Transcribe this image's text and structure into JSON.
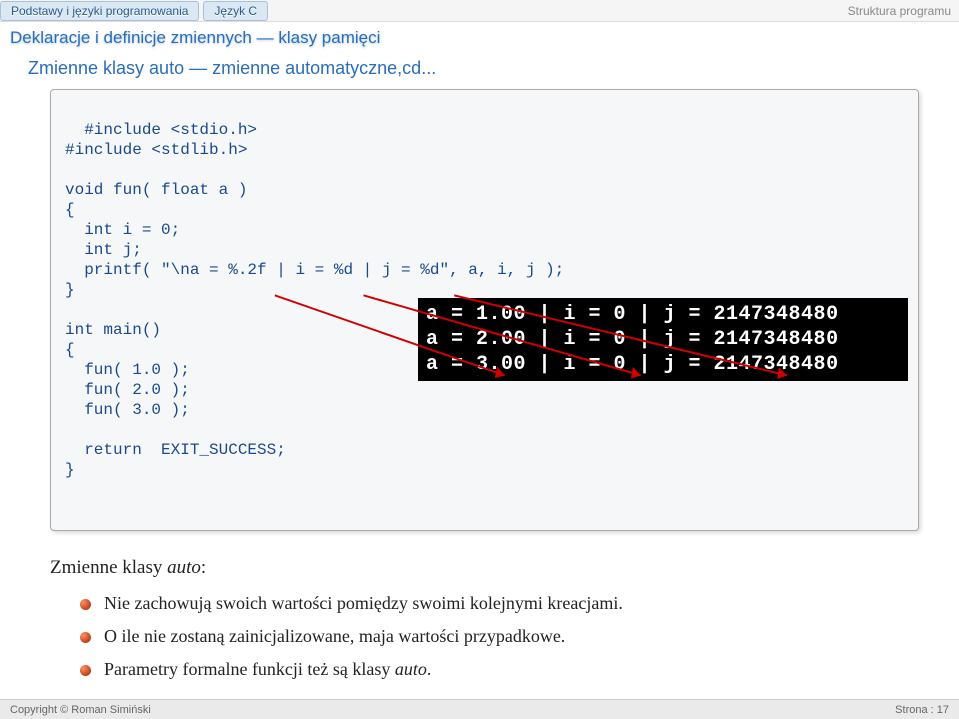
{
  "header": {
    "crumb1": "Podstawy i języki programowania",
    "crumb2": "Język C",
    "right": "Struktura programu"
  },
  "subtitle": "Deklaracje i definicje zmiennych ― klasy pamięci",
  "section_title": "Zmienne klasy auto ― zmienne automatyczne,cd...",
  "code": "#include <stdio.h>\n#include <stdlib.h>\n\nvoid fun( float a )\n{\n  int i = 0;\n  int j;\n  printf( \"\\na = %.2f | i = %d | j = %d\", a, i, j );\n}\n\nint main()\n{\n  fun( 1.0 );\n  fun( 2.0 );\n  fun( 3.0 );\n\n  return  EXIT_SUCCESS;\n}",
  "terminal": "a = 1.00 | i = 0 | j = 2147348480\na = 2.00 | i = 0 | j = 2147348480\na = 3.00 | i = 0 | j = 2147348480",
  "body": {
    "lead": "Zmienne klasy ",
    "lead_em": "auto",
    "lead_tail": ":",
    "bullet1": "Nie zachowują swoich wartości pomiędzy swoimi kolejnymi kreacjami.",
    "bullet2": "O ile nie zostaną zainicjalizowane, maja wartości przypadkowe.",
    "bullet3_a": "Parametry formalne funkcji też są klasy ",
    "bullet3_em": "auto",
    "bullet3_b": "."
  },
  "footer": {
    "left": "Copyright © Roman Simiński",
    "right": "Strona : 17"
  }
}
